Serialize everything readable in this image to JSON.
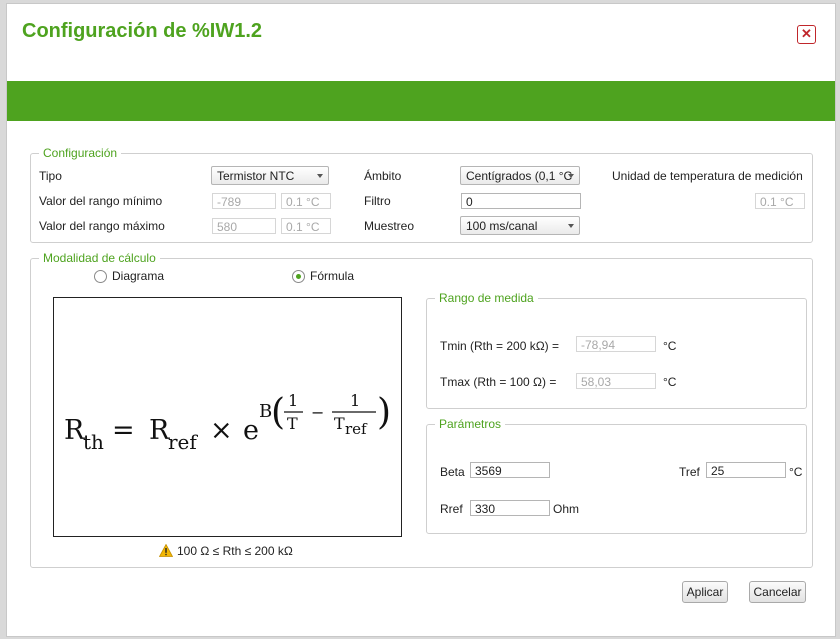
{
  "dialog": {
    "title": "Configuración de %IW1.2",
    "close_label": "✕"
  },
  "config": {
    "legend": "Configuración",
    "tipo_label": "Tipo",
    "tipo_value": "Termistor NTC",
    "min_label": "Valor del rango mínimo",
    "min_value": "-789",
    "min_unit": "0.1 °C",
    "max_label": "Valor del rango máximo",
    "max_value": "580",
    "max_unit": "0.1 °C",
    "ambito_label": "Ámbito",
    "ambito_value": "Centígrados (0,1 °C",
    "filtro_label": "Filtro",
    "filtro_value": "0",
    "muestreo_label": "Muestreo",
    "muestreo_value": "100 ms/canal",
    "unidad_label": "Unidad de temperatura de medición",
    "unidad_value": "0.1 °C"
  },
  "calc": {
    "legend": "Modalidad de cálculo",
    "diagrama_label": "Diagrama",
    "formula_label": "Fórmula",
    "selected": "formula",
    "formula": {
      "R": "R",
      "th": "th",
      "eq": "=",
      "ref": "ref",
      "times": "×",
      "e": "e",
      "B": "B",
      "one": "1",
      "T": "T",
      "minus": "−",
      "Tref_T": "T",
      "lparen": "(",
      "rparen": ")"
    },
    "warning": "100 Ω ≤ Rth ≤ 200 kΩ"
  },
  "rango": {
    "legend": "Rango de medida",
    "tmin_label": "Tmin (Rth = 200 kΩ) =",
    "tmin_value": "-78,94",
    "tmin_unit": "°C",
    "tmax_label": "Tmax (Rth = 100 Ω) =",
    "tmax_value": "58,03",
    "tmax_unit": "°C"
  },
  "params": {
    "legend": "Parámetros",
    "beta_label": "Beta",
    "beta_value": "3569",
    "tref_label": "Tref",
    "tref_value": "25",
    "tref_unit": "°C",
    "rref_label": "Rref",
    "rref_value": "330",
    "rref_unit": "Ohm"
  },
  "buttons": {
    "apply": "Aplicar",
    "cancel": "Cancelar"
  },
  "colors": {
    "accent": "#4ea31f",
    "close": "#c0262b",
    "warning": "#f2b705"
  },
  "icons": {
    "close": "close-icon",
    "warning": "warning-icon",
    "combo_arrow": "chevron-down-icon"
  }
}
